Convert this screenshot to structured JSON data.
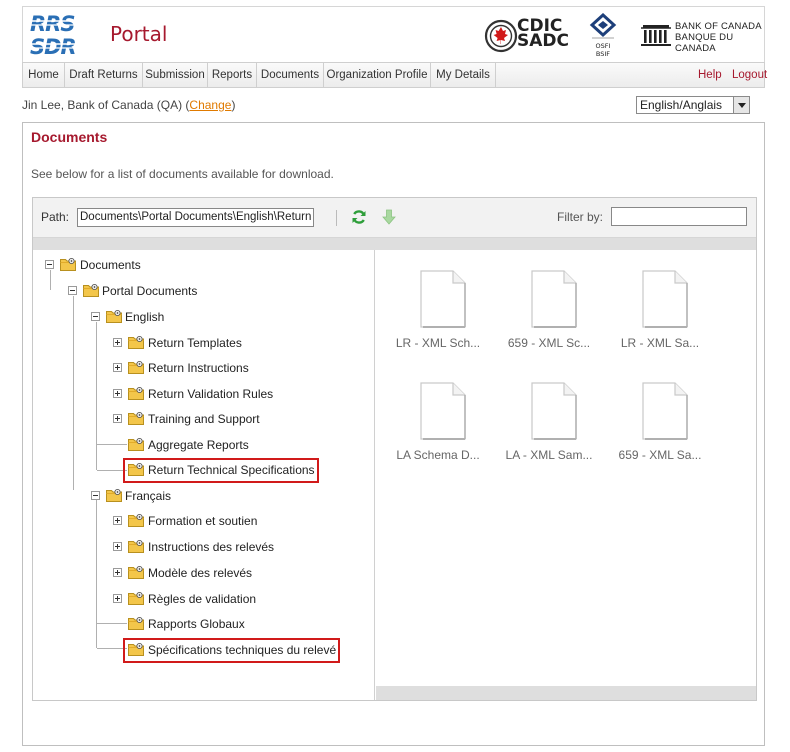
{
  "header": {
    "logo_text": "RRS SDR",
    "portal_title": "Portal",
    "cdic_text_line1": "CDIC",
    "cdic_text_line2": "SADC",
    "osfi_text_line1": "OSFI",
    "osfi_text_line2": "BSIF",
    "boc_text_line1": "BANK OF CANADA",
    "boc_text_line2": "BANQUE DU CANADA"
  },
  "nav": {
    "items": [
      "Home",
      "Draft Returns",
      "Submission",
      "Reports",
      "Documents",
      "Organization Profile",
      "My Details"
    ],
    "help": "Help",
    "logout": "Logout"
  },
  "user": {
    "text": "Jin Lee, Bank of Canada (QA) (",
    "change": "Change",
    "close": ")",
    "language": "English/Anglais"
  },
  "main": {
    "title": "Documents",
    "description": "See below for a list of documents available for download."
  },
  "toolbar": {
    "path_label": "Path:",
    "path_value": "Documents\\Portal Documents\\English\\Return Technical Specifications",
    "filter_label": "Filter by:",
    "filter_value": ""
  },
  "tree": {
    "root": "Documents",
    "portal": "Portal Documents",
    "english": "English",
    "english_children": [
      "Return Templates",
      "Return Instructions",
      "Return Validation Rules",
      "Training and Support",
      "Aggregate Reports",
      "Return Technical Specifications"
    ],
    "francais": "Français",
    "francais_children": [
      "Formation et soutien",
      "Instructions des relevés",
      "Modèle des relevés",
      "Règles de validation",
      "Rapports Globaux",
      "Spécifications techniques du relevé"
    ]
  },
  "files": [
    "LR - XML Sch...",
    "659 - XML Sc...",
    "LR - XML Sa...",
    "LA Schema D...",
    "LA - XML Sam...",
    "659 - XML Sa..."
  ],
  "colors": {
    "brand_red": "#a6192e",
    "highlight_red": "#d11a1a",
    "link_orange": "#e07a00",
    "refresh_green": "#2e9e3a",
    "download_green": "#a9d8a0"
  }
}
